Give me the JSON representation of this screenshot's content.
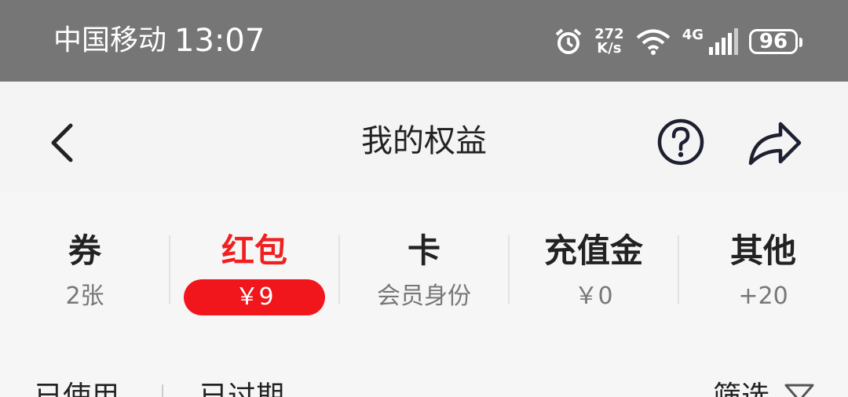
{
  "status_bar": {
    "carrier": "中国移动",
    "time": "13:07",
    "speed_top": "272",
    "speed_unit": "K/s",
    "network": "4G",
    "battery": "96"
  },
  "nav": {
    "title": "我的权益"
  },
  "tabs": [
    {
      "title": "券",
      "sub": "2张"
    },
    {
      "title": "红包",
      "badge": "￥9"
    },
    {
      "title": "卡",
      "sub": "会员身份"
    },
    {
      "title": "充值金",
      "sub": "￥0"
    },
    {
      "title": "其他",
      "sub": "+20"
    }
  ],
  "filters": {
    "used": "已使用",
    "expired": "已过期",
    "filter": "筛选"
  },
  "colors": {
    "accent": "#f12020",
    "status_bar": "#767676"
  }
}
